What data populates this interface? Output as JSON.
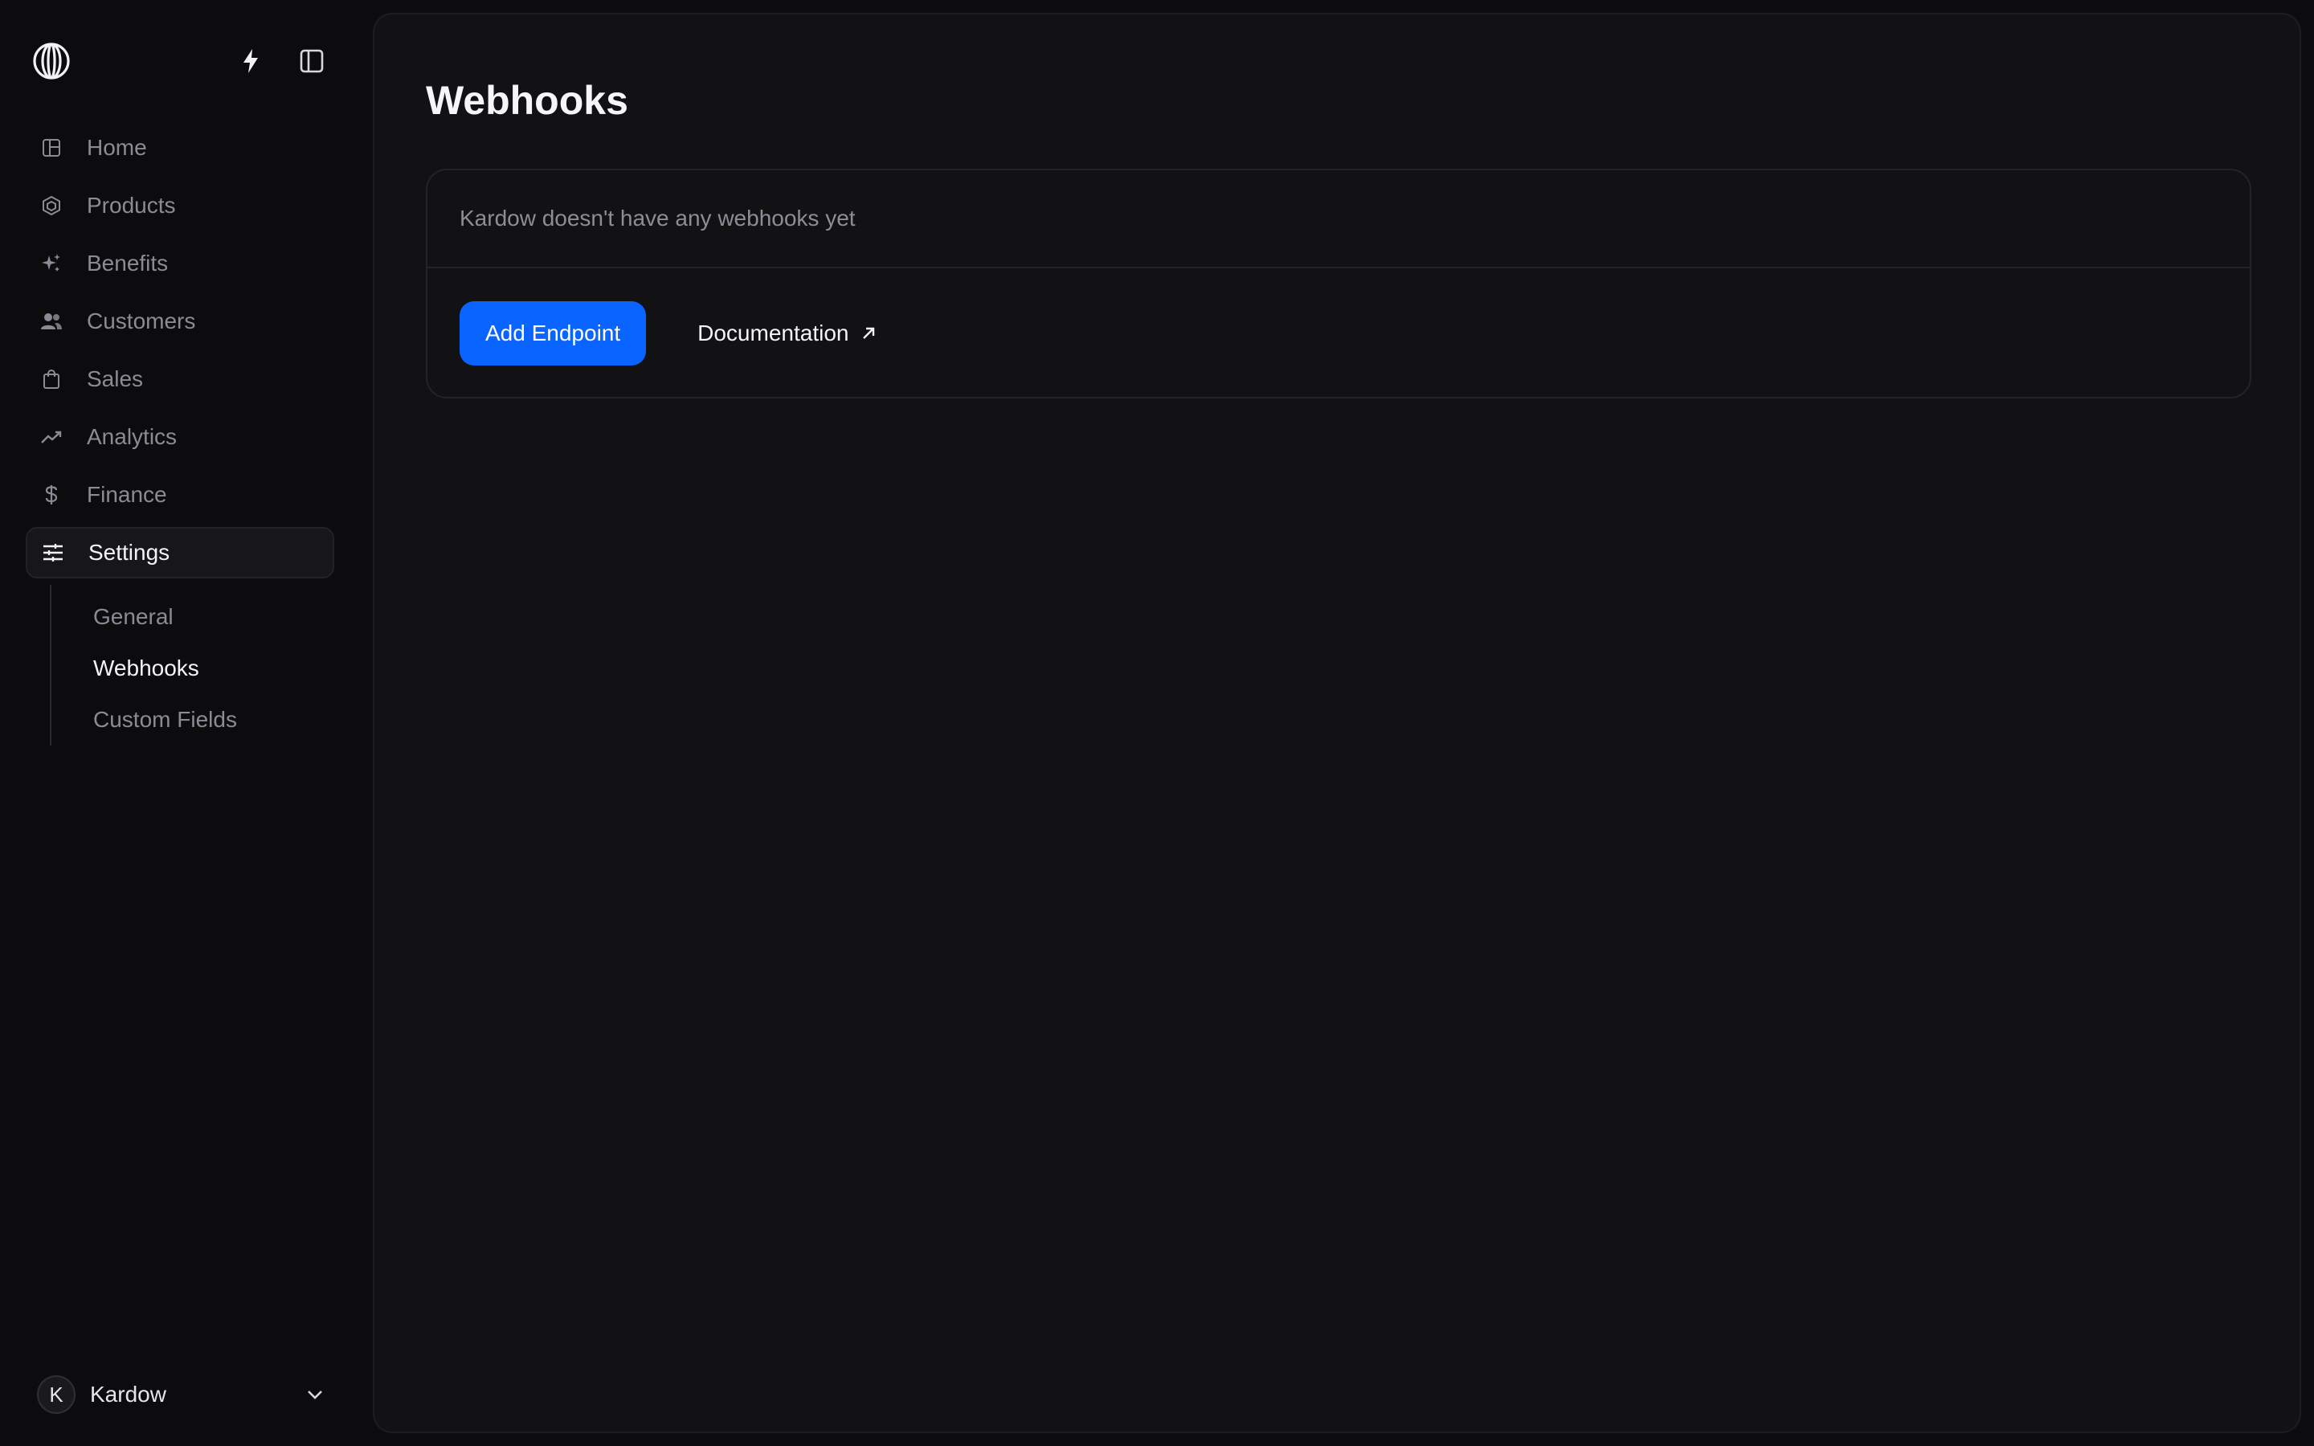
{
  "sidebar": {
    "logo_icon": "polar-globe-logo",
    "top_icons": [
      "bolt-icon",
      "sidebar-toggle-icon"
    ],
    "items": [
      {
        "label": "Home",
        "icon": "home-grid-icon"
      },
      {
        "label": "Products",
        "icon": "products-hex-icon"
      },
      {
        "label": "Benefits",
        "icon": "sparkles-icon"
      },
      {
        "label": "Customers",
        "icon": "users-icon"
      },
      {
        "label": "Sales",
        "icon": "shopping-bag-icon"
      },
      {
        "label": "Analytics",
        "icon": "trending-up-icon"
      },
      {
        "label": "Finance",
        "icon": "dollar-icon"
      },
      {
        "label": "Settings",
        "icon": "sliders-icon",
        "active": true
      }
    ],
    "settings_subitems": [
      {
        "label": "General"
      },
      {
        "label": "Webhooks",
        "active": true
      },
      {
        "label": "Custom Fields"
      }
    ],
    "account": {
      "initial": "K",
      "name": "Kardow"
    }
  },
  "main": {
    "title": "Webhooks",
    "empty_message": "Kardow doesn't have any webhooks yet",
    "add_endpoint_label": "Add Endpoint",
    "documentation_label": "Documentation"
  },
  "colors": {
    "accent": "#0a64ff",
    "background": "#0c0c0e",
    "panel": "#121215",
    "muted_text": "#8b8b95"
  }
}
